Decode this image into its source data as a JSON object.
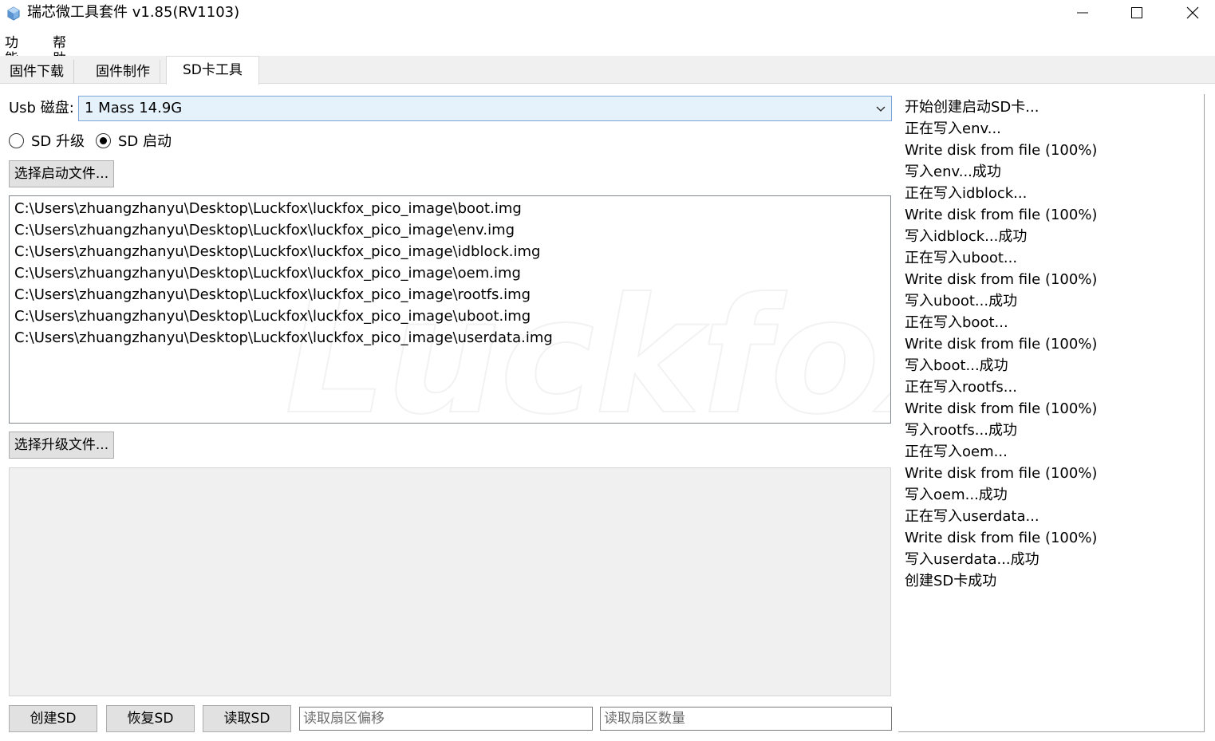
{
  "window": {
    "title": "瑞芯微工具套件 v1.85(RV1103)"
  },
  "menu": {
    "items": [
      "功能",
      "帮助"
    ]
  },
  "tabs": [
    "固件下载",
    "固件制作",
    "SD卡工具"
  ],
  "usb": {
    "label": "Usb 磁盘:",
    "selected": "1 Mass 14.9G"
  },
  "mode": {
    "upgrade_label": "SD 升级",
    "boot_label": "SD 启动",
    "selected": "SD 启动"
  },
  "buttons": {
    "select_boot": "选择启动文件...",
    "select_upgrade": "选择升级文件...",
    "create_sd": "创建SD",
    "restore_sd": "恢复SD",
    "read_sd": "读取SD"
  },
  "files": [
    "C:\\Users\\zhuangzhanyu\\Desktop\\Luckfox\\luckfox_pico_image\\boot.img",
    "C:\\Users\\zhuangzhanyu\\Desktop\\Luckfox\\luckfox_pico_image\\env.img",
    "C:\\Users\\zhuangzhanyu\\Desktop\\Luckfox\\luckfox_pico_image\\idblock.img",
    "C:\\Users\\zhuangzhanyu\\Desktop\\Luckfox\\luckfox_pico_image\\oem.img",
    "C:\\Users\\zhuangzhanyu\\Desktop\\Luckfox\\luckfox_pico_image\\rootfs.img",
    "C:\\Users\\zhuangzhanyu\\Desktop\\Luckfox\\luckfox_pico_image\\uboot.img",
    "C:\\Users\\zhuangzhanyu\\Desktop\\Luckfox\\luckfox_pico_image\\userdata.img"
  ],
  "watermark": "Luckfox",
  "inputs": {
    "sector_offset_placeholder": "读取扇区偏移",
    "sector_count_placeholder": "读取扇区数量"
  },
  "log": [
    "开始创建启动SD卡...",
    "正在写入env...",
    "Write disk from file (100%)",
    "写入env...成功",
    "正在写入idblock...",
    "Write disk from file (100%)",
    "写入idblock...成功",
    "正在写入uboot...",
    "Write disk from file (100%)",
    "写入uboot...成功",
    "正在写入boot...",
    "Write disk from file (100%)",
    "写入boot...成功",
    "正在写入rootfs...",
    "Write disk from file (100%)",
    "写入rootfs...成功",
    "正在写入oem...",
    "Write disk from file (100%)",
    "写入oem...成功",
    "正在写入userdata...",
    "Write disk from file (100%)",
    "写入userdata...成功",
    "创建SD卡成功"
  ]
}
